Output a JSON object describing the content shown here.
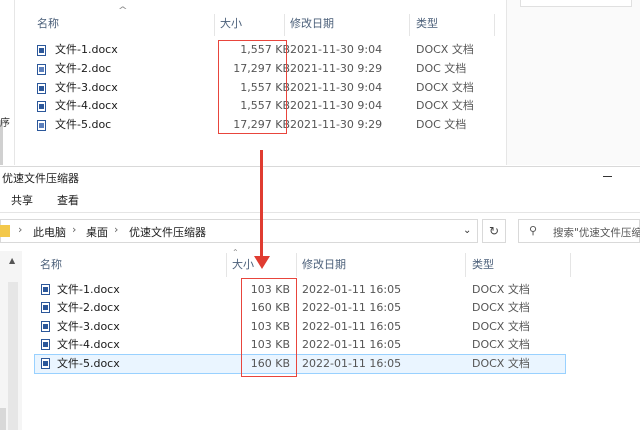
{
  "top_window": {
    "columns": {
      "name": "名称",
      "size": "大小",
      "modified": "修改日期",
      "type": "类型"
    },
    "files": [
      {
        "name": "文件-1.docx",
        "size": "1,557 KB",
        "modified": "2021-11-30 9:04",
        "type": "DOCX 文档",
        "icon": "docx-icon"
      },
      {
        "name": "文件-2.doc",
        "size": "17,297 KB",
        "modified": "2021-11-30 9:29",
        "type": "DOC 文档",
        "icon": "doc-icon"
      },
      {
        "name": "文件-3.docx",
        "size": "1,557 KB",
        "modified": "2021-11-30 9:04",
        "type": "DOCX 文档",
        "icon": "docx-icon"
      },
      {
        "name": "文件-4.docx",
        "size": "1,557 KB",
        "modified": "2021-11-30 9:04",
        "type": "DOCX 文档",
        "icon": "docx-icon"
      },
      {
        "name": "文件-5.doc",
        "size": "17,297 KB",
        "modified": "2021-11-30 9:29",
        "type": "DOC 文档",
        "icon": "doc-icon"
      }
    ],
    "edge_char": "序"
  },
  "bottom_window": {
    "title": "优速文件压缩器",
    "ribbon_tabs": [
      "共享",
      "查看"
    ],
    "breadcrumb": [
      "此电脑",
      "桌面",
      "优速文件压缩器"
    ],
    "breadcrumb_separator": "›",
    "search_placeholder": "搜索\"优速文件压缩",
    "columns": {
      "name": "名称",
      "size": "大小",
      "modified": "修改日期",
      "type": "类型"
    },
    "files": [
      {
        "name": "文件-1.docx",
        "size": "103 KB",
        "modified": "2022-01-11 16:05",
        "type": "DOCX 文档",
        "icon": "docx-icon"
      },
      {
        "name": "文件-2.docx",
        "size": "160 KB",
        "modified": "2022-01-11 16:05",
        "type": "DOCX 文档",
        "icon": "docx-icon"
      },
      {
        "name": "文件-3.docx",
        "size": "103 KB",
        "modified": "2022-01-11 16:05",
        "type": "DOCX 文档",
        "icon": "docx-icon"
      },
      {
        "name": "文件-4.docx",
        "size": "103 KB",
        "modified": "2022-01-11 16:05",
        "type": "DOCX 文档",
        "icon": "docx-icon"
      },
      {
        "name": "文件-5.docx",
        "size": "160 KB",
        "modified": "2022-01-11 16:05",
        "type": "DOCX 文档",
        "icon": "docx-icon",
        "selected": true
      }
    ]
  },
  "colors": {
    "highlight_red": "#e8453c",
    "header_text": "#4c607a",
    "selection": "#eaf5ff"
  }
}
